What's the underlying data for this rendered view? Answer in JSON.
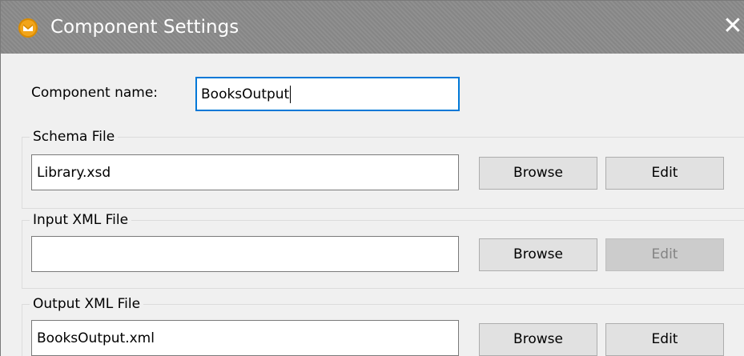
{
  "window": {
    "title": "Component Settings",
    "close_symbol": "✕"
  },
  "component_name": {
    "label": "Component name:",
    "value": "BooksOutput"
  },
  "schema_file": {
    "group_label": "Schema File",
    "value": "Library.xsd",
    "browse_label": "Browse",
    "edit_label": "Edit"
  },
  "input_xml_file": {
    "group_label": "Input XML File",
    "value": "",
    "browse_label": "Browse",
    "edit_label": "Edit",
    "edit_enabled": false
  },
  "output_xml_file": {
    "group_label": "Output XML File",
    "value": "BooksOutput.xml",
    "browse_label": "Browse",
    "edit_label": "Edit"
  },
  "colors": {
    "titlebar": "#8b8b8b",
    "focus_border": "#0078d7",
    "app_icon": "#f2a51a",
    "button": "#e1e1e1",
    "button_disabled": "#cccccc"
  },
  "icons": {
    "app": "mapforce-app-icon",
    "close": "close-icon"
  }
}
